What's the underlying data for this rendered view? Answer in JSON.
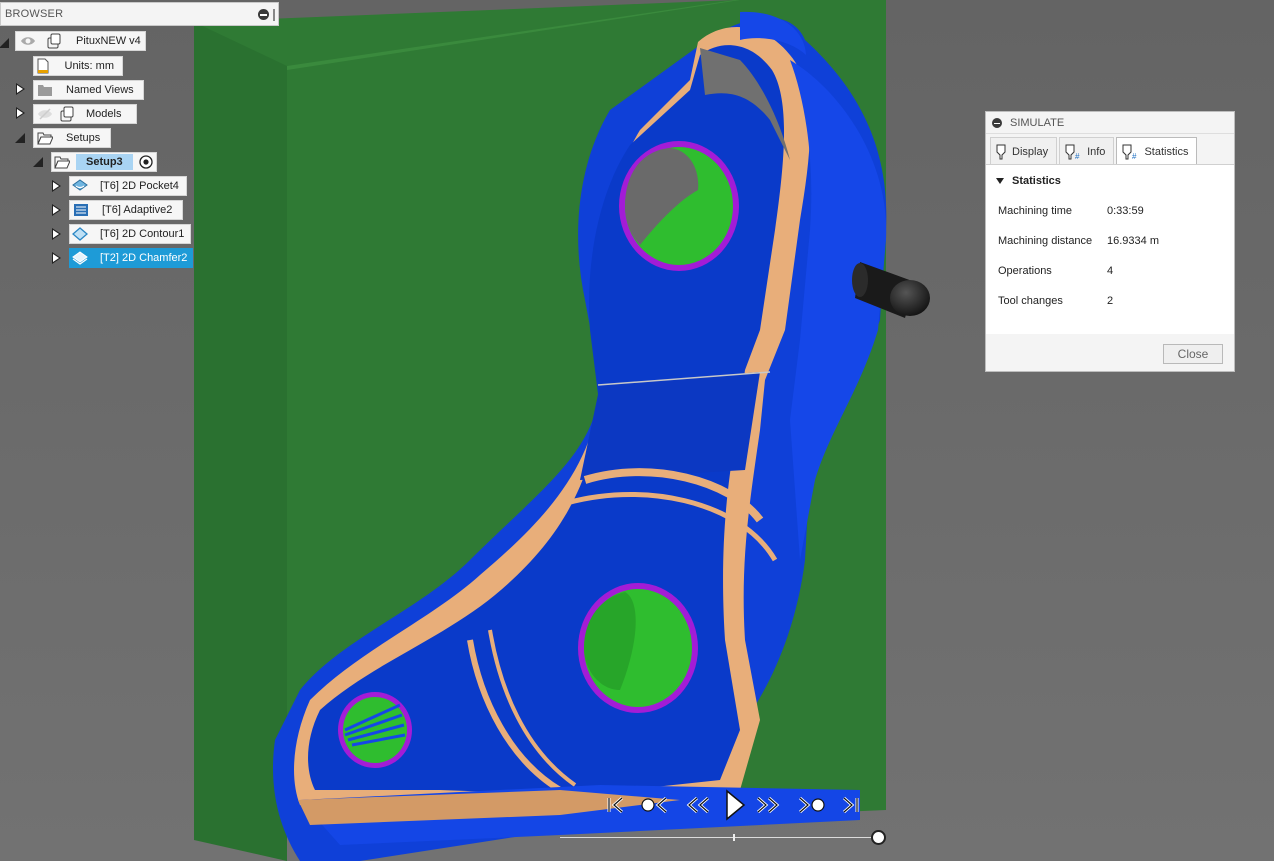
{
  "browser": {
    "title": "BROWSER",
    "root": "PituxNEW v4",
    "units": "Units: mm",
    "named_views": "Named Views",
    "models": "Models",
    "setups": "Setups",
    "setup": "Setup3",
    "operations": [
      {
        "label": "[T6] 2D Pocket4",
        "selected": false
      },
      {
        "label": "[T6] Adaptive2",
        "selected": false
      },
      {
        "label": "[T6] 2D Contour1",
        "selected": false
      },
      {
        "label": "[T2] 2D Chamfer2",
        "selected": true
      }
    ]
  },
  "simulate": {
    "title": "SIMULATE",
    "tabs": [
      "Display",
      "Info",
      "Statistics"
    ],
    "active_tab": "Statistics",
    "section": "Statistics",
    "stats": [
      {
        "label": "Machining time",
        "value": "0:33:59"
      },
      {
        "label": "Machining distance",
        "value": "16.9334 m"
      },
      {
        "label": "Operations",
        "value": "4"
      },
      {
        "label": "Tool changes",
        "value": "2"
      }
    ],
    "close_label": "Close"
  },
  "playback": {
    "progress": 1.0,
    "controls": [
      "skip-to-start-icon",
      "previous-operation-icon",
      "step-back-icon",
      "play-icon",
      "step-forward-icon",
      "next-operation-icon",
      "skip-to-end-icon"
    ]
  },
  "colors": {
    "stock": "#2f7a34",
    "part_blue": "#0a3ac9",
    "bright_blue": "#1446e6",
    "tan": "#e8ae7a",
    "hole_green": "#2fbd2f",
    "hole_rim": "#a31cd6",
    "background": "#6b6b6b",
    "selection": "#1e9bd7"
  }
}
